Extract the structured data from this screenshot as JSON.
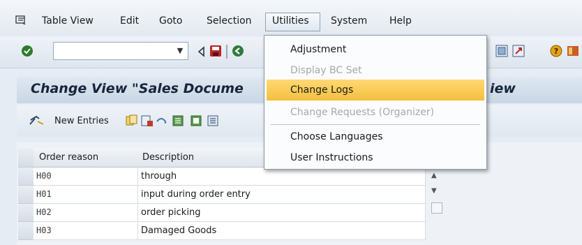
{
  "menubar": {
    "items": [
      {
        "label": "Table View"
      },
      {
        "label": "Edit"
      },
      {
        "label": "Goto"
      },
      {
        "label": "Selection"
      },
      {
        "label": "Utilities"
      },
      {
        "label": "System"
      },
      {
        "label": "Help"
      }
    ]
  },
  "toolbar": {
    "command_field_value": ""
  },
  "title": {
    "text": "Change View \"Sales Docume",
    "tail": "iew"
  },
  "app_toolbar": {
    "new_entries_label": "New Entries"
  },
  "table": {
    "columns": [
      "Order reason",
      "Description"
    ],
    "rows": [
      {
        "code": "H00",
        "description": "through"
      },
      {
        "code": "H01",
        "description": "input during order entry"
      },
      {
        "code": "H02",
        "description": "order picking"
      },
      {
        "code": "H03",
        "description": "Damaged Goods"
      }
    ]
  },
  "utilities_menu": {
    "items": [
      {
        "label": "Adjustment",
        "enabled": true
      },
      {
        "label": "Display BC Set",
        "enabled": false
      },
      {
        "label": "Change Logs",
        "enabled": true,
        "selected": true
      },
      {
        "label": "Change Requests (Organizer)",
        "enabled": false
      },
      {
        "label": "Choose Languages",
        "enabled": true
      },
      {
        "label": "User Instructions",
        "enabled": true
      }
    ]
  },
  "colors": {
    "highlight": "#f3bf3e",
    "title_text": "#16253a",
    "disabled_text": "#a8a8a8"
  }
}
